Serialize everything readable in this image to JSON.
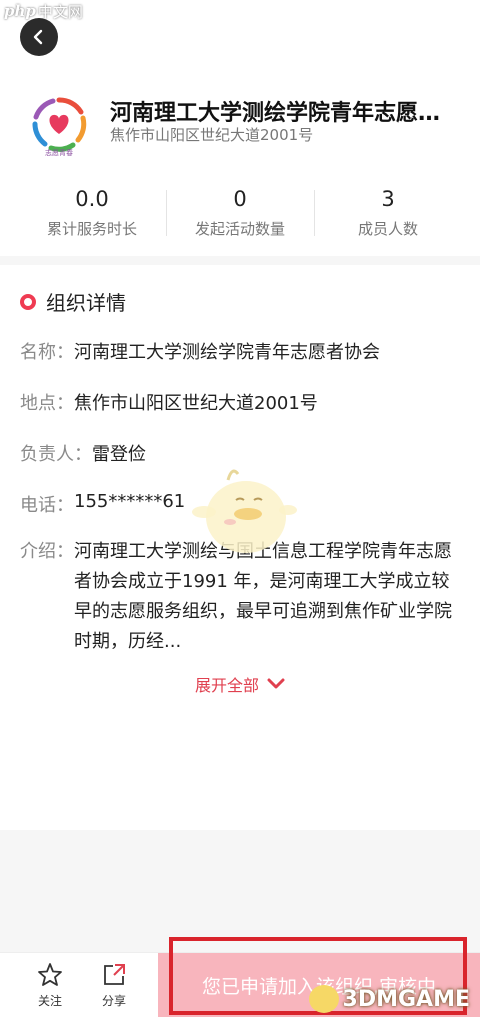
{
  "watermark": {
    "php": "php",
    "site": "中文网",
    "brand": "3DMGAME"
  },
  "header": {
    "org_name": "河南理工大学测绘学院青年志愿者...",
    "address": "焦作市山阳区世纪大道2001号",
    "logo_icon": "heart-circle-logo",
    "logo_caption": "志愿青春"
  },
  "stats": [
    {
      "value": "0.0",
      "label": "累计服务时长"
    },
    {
      "value": "0",
      "label": "发起活动数量"
    },
    {
      "value": "3",
      "label": "成员人数"
    }
  ],
  "details": {
    "title": "组织详情",
    "name_key": "名称：",
    "name_value": "河南理工大学测绘学院青年志愿者协会",
    "location_key": "地点：",
    "location_value": "焦作市山阳区世纪大道2001号",
    "leader_key": "负责人：",
    "leader_value": "雷登俭",
    "phone_key": "电话：",
    "phone_value": "155******61",
    "intro_key": "介绍：",
    "intro_value": "河南理工大学测绘与国土信息工程学院青年志愿者协会成立于1991 年，是河南理工大学成立较早的志愿服务组织，最早可追溯到焦作矿业学院时期，历经...",
    "expand_label": "展开全部"
  },
  "bottom_bar": {
    "follow_label": "关注",
    "share_label": "分享",
    "apply_label": "您已申请加入该组织,审核中"
  },
  "colors": {
    "accent": "#ef3b52",
    "apply_bg": "#f8b5bd",
    "frame": "#d9242c"
  }
}
